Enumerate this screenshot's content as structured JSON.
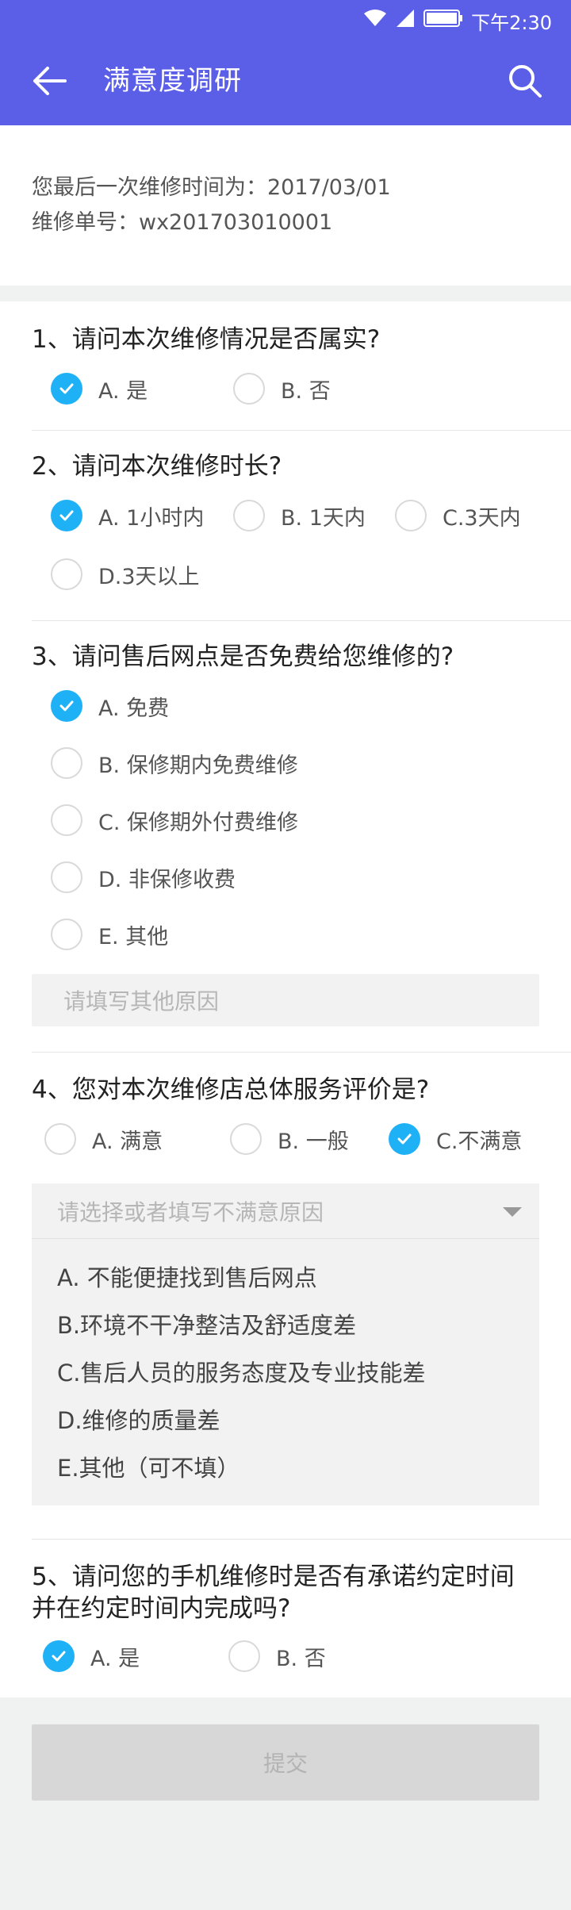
{
  "status_bar": {
    "time": "下午2:30"
  },
  "app_bar": {
    "title": "满意度调研"
  },
  "info": {
    "line1": "您最后一次维修时间为：2017/03/01",
    "line2": "维修单号：wx201703010001"
  },
  "questions": [
    {
      "title": "1、请问本次维修情况是否属实?",
      "options": [
        "A. 是",
        "B. 否"
      ],
      "selected": 0
    },
    {
      "title": "2、请问本次维修时长?",
      "options": [
        "A. 1小时内",
        "B. 1天内",
        "C.3天内",
        "D.3天以上"
      ],
      "selected": 0
    },
    {
      "title": "3、请问售后网点是否免费给您维修的?",
      "options": [
        "A.  免费",
        "B. 保修期内免费维修",
        "C. 保修期外付费维修",
        "D. 非保修收费",
        "E. 其他"
      ],
      "selected": 0,
      "other_placeholder": "请填写其他原因"
    },
    {
      "title": "4、您对本次维修店总体服务评价是?",
      "options": [
        "A. 满意",
        "B. 一般",
        "C.不满意"
      ],
      "selected": 2,
      "reason_placeholder": "请选择或者填写不满意原因",
      "reasons": [
        "A. 不能便捷找到售后网点",
        "B.环境不干净整洁及舒适度差",
        "C.售后人员的服务态度及专业技能差",
        "D.维修的质量差",
        "E.其他（可不填）"
      ]
    },
    {
      "title_line1": "5、请问您的手机维修时是否有承诺约定时间",
      "title_line2": "并在约定时间内完成吗?",
      "options": [
        "A. 是",
        "B. 否"
      ],
      "selected": 0
    }
  ],
  "submit_label": "提交",
  "colors": {
    "primary": "#5b5fe8",
    "check": "#1fb1f6"
  }
}
